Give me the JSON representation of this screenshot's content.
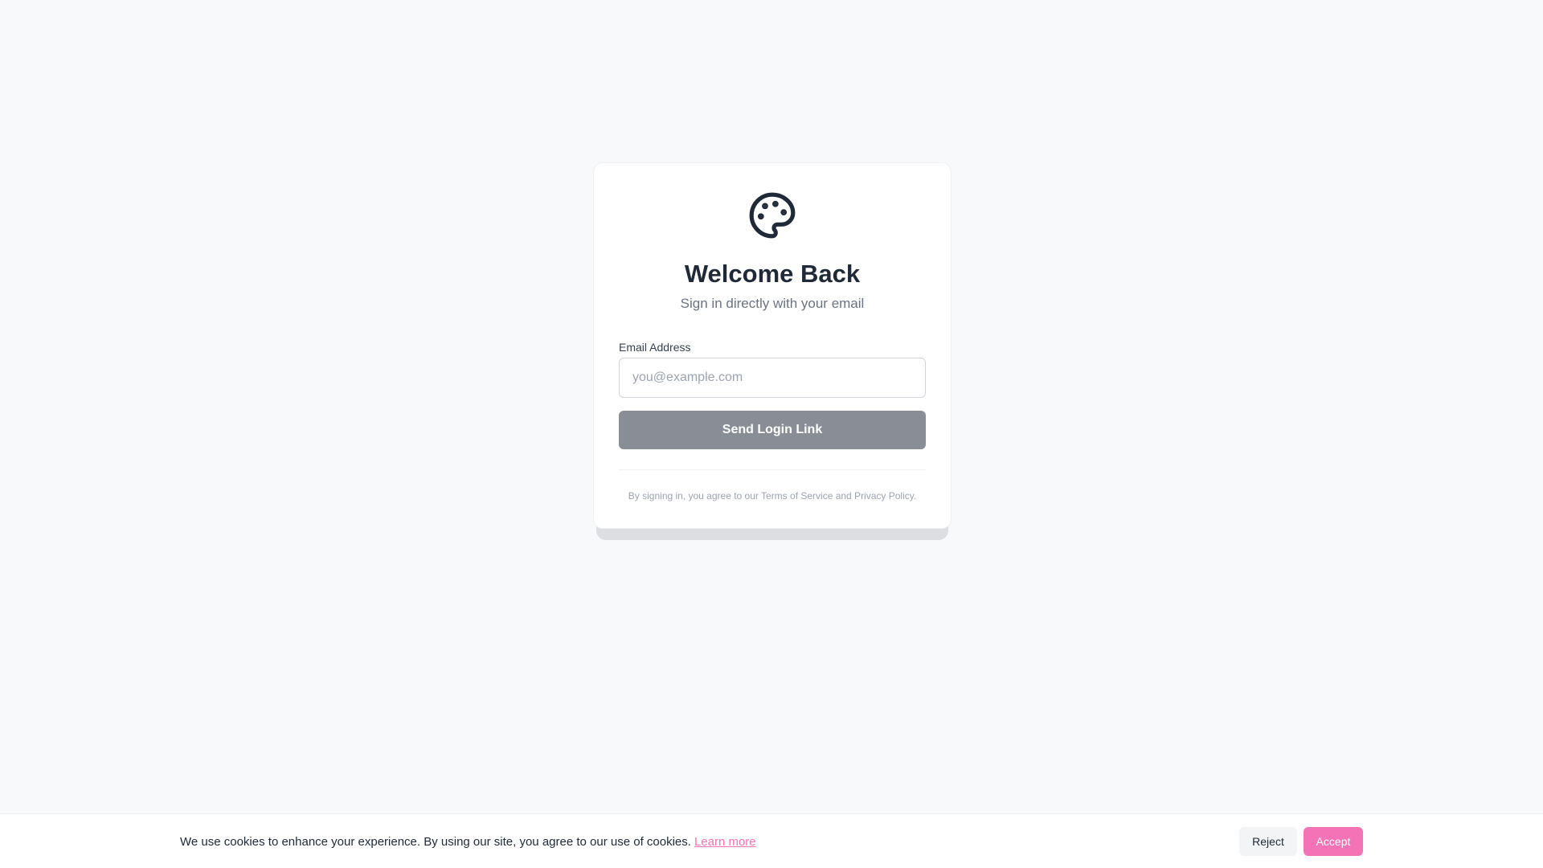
{
  "login": {
    "logo_icon": "palette-icon",
    "title": "Welcome Back",
    "subtitle": "Sign in directly with your email",
    "email_label": "Email Address",
    "email_value": "",
    "email_placeholder": "you@example.com",
    "submit_label": "Send Login Link",
    "legal_text": "By signing in, you agree to our Terms of Service and Privacy Policy."
  },
  "cookie_banner": {
    "message": "We use cookies to enhance your experience. By using our site, you agree to our use of cookies.",
    "learn_more_label": "Learn more",
    "reject_label": "Reject",
    "accept_label": "Accept"
  },
  "colors": {
    "background": "#f8f9fb",
    "card": "#ffffff",
    "text_primary": "#1f2937",
    "text_secondary": "#6b7280",
    "text_muted": "#9ca3af",
    "button_disabled": "#898e96",
    "accent": "#f472b6"
  }
}
